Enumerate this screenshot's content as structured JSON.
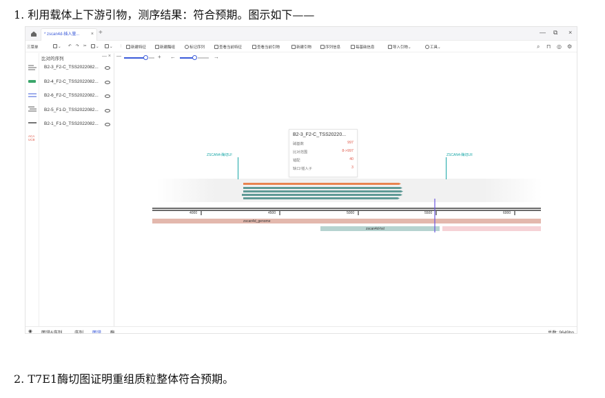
{
  "doc": {
    "line1": "1. 利用载体上下游引物，测序结果：符合预期。图示如下——",
    "line2": "2. T7E1酶切图证明重组质粒整体符合预期。"
  },
  "app": {
    "tab_title": "* zscan4d-插入量...",
    "tab_close": "×",
    "tab_add": "+",
    "window_controls": {
      "minimize": "—",
      "restore": "⧉",
      "close": "×"
    }
  },
  "toolbar": {
    "menu": "三菜单",
    "new_feature": "新建特征",
    "new_primer": "新建酶组",
    "mark_seq": "标记序列",
    "view_features": "查看当前特征",
    "view_primers": "查看当前引物",
    "new_primer2": "新建引物",
    "seq_info": "序列信息",
    "base_info": "每基础信息",
    "import_primer": "导入引物",
    "tools": "工具"
  },
  "sidebar": {
    "header": "比对的序列",
    "close": "— ×",
    "items": [
      {
        "label": "B2-3_F2-C_TSS2022082..."
      },
      {
        "label": "B2-4_F2-C_TSS2022082..."
      },
      {
        "label": "B2-6_F2-C_TSS2022082..."
      },
      {
        "label": "B2-5_F1-D_TSS2022082..."
      },
      {
        "label": "B2-1_F1-D_TSS2022082..."
      }
    ],
    "abc_icon_text": "ACA\nUCB"
  },
  "zoom": {
    "plus": "+",
    "minus": "+",
    "left": "←",
    "right": "→"
  },
  "popup": {
    "title": "B2-3_F2-C_TSS20220...",
    "rows": [
      {
        "label": "碱基数",
        "value": "997"
      },
      {
        "label": "比对范围",
        "value": "8->997"
      },
      {
        "label": "错配",
        "value": "40"
      },
      {
        "label": "缺口/插入子",
        "value": "3"
      }
    ]
  },
  "primers": {
    "left": "ZSCAN4-酶切LF",
    "right": "ZSCAN4-酶切LR"
  },
  "ruler": {
    "ticks": [
      "4000",
      "4500",
      "5000",
      "5500",
      "6000"
    ]
  },
  "features": {
    "genome": "zscan4d_genome",
    "hsl": "zscan4d-hsl"
  },
  "colors": {
    "accent": "#3a5ad9",
    "primer": "#17a6a6",
    "read_orange": "#e8834f",
    "read_teal": "#5f9a96",
    "genome": "#e3b8ad",
    "hsl": "#b6d3d0",
    "pink": "#f6d2d6",
    "cursor": "#6a55e0"
  },
  "statusbar": {
    "tabs": [
      "图谱&序列",
      "序列",
      "图谱",
      "酶"
    ],
    "active": "图谱",
    "total": "总数: 9649bp"
  }
}
